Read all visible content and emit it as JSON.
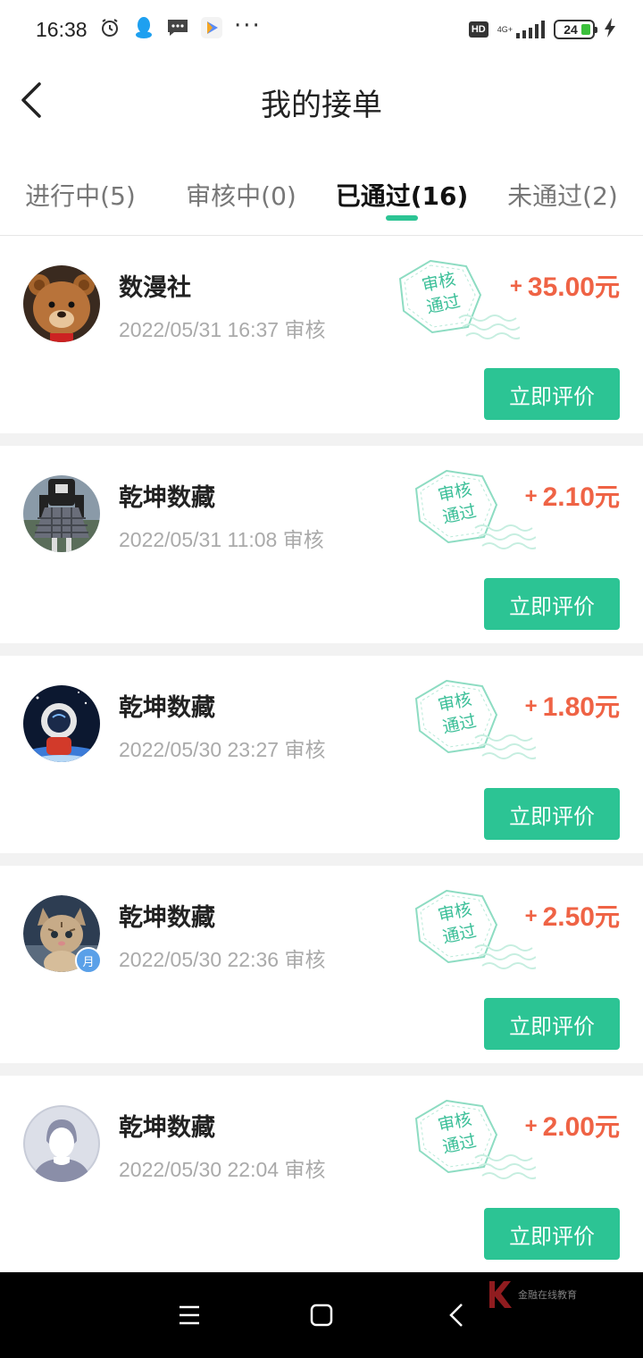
{
  "status_bar": {
    "time": "16:38",
    "hd": "HD",
    "network": "4G+",
    "battery": "24"
  },
  "header": {
    "title": "我的接单"
  },
  "tabs": [
    {
      "label": "进行中(5)",
      "active": false
    },
    {
      "label": "审核中(0)",
      "active": false
    },
    {
      "label": "已通过(16)",
      "active": true
    },
    {
      "label": "未通过(2)",
      "active": false
    }
  ],
  "orders": [
    {
      "name": "数漫社",
      "time": "2022/05/31 16:37",
      "time_suffix": "审核",
      "stamp_line1": "审核",
      "stamp_line2": "通过",
      "amount_sign": "+",
      "amount": "35.00",
      "unit": "元",
      "button": "立即评价",
      "avatar": "teddy-bear-avatar"
    },
    {
      "name": "乾坤数藏",
      "time": "2022/05/31 11:08",
      "time_suffix": "审核",
      "stamp_line1": "审核",
      "stamp_line2": "通过",
      "amount_sign": "+",
      "amount": "2.10",
      "unit": "元",
      "button": "立即评价",
      "avatar": "girl-skirt-avatar"
    },
    {
      "name": "乾坤数藏",
      "time": "2022/05/30 23:27",
      "time_suffix": "审核",
      "stamp_line1": "审核",
      "stamp_line2": "通过",
      "amount_sign": "+",
      "amount": "1.80",
      "unit": "元",
      "button": "立即评价",
      "avatar": "astronaut-avatar"
    },
    {
      "name": "乾坤数藏",
      "time": "2022/05/30 22:36",
      "time_suffix": "审核",
      "stamp_line1": "审核",
      "stamp_line2": "通过",
      "amount_sign": "+",
      "amount": "2.50",
      "unit": "元",
      "button": "立即评价",
      "avatar": "kitten-avatar",
      "badge": "月"
    },
    {
      "name": "乾坤数藏",
      "time": "2022/05/30 22:04",
      "time_suffix": "审核",
      "stamp_line1": "审核",
      "stamp_line2": "通过",
      "amount_sign": "+",
      "amount": "2.00",
      "unit": "元",
      "button": "立即评价",
      "avatar": "default-user-avatar"
    }
  ],
  "watermark": {
    "text": "金融在线教育"
  },
  "colors": {
    "accent": "#2cc494",
    "amount": "#ef6345",
    "stamp": "#3bbf98"
  }
}
